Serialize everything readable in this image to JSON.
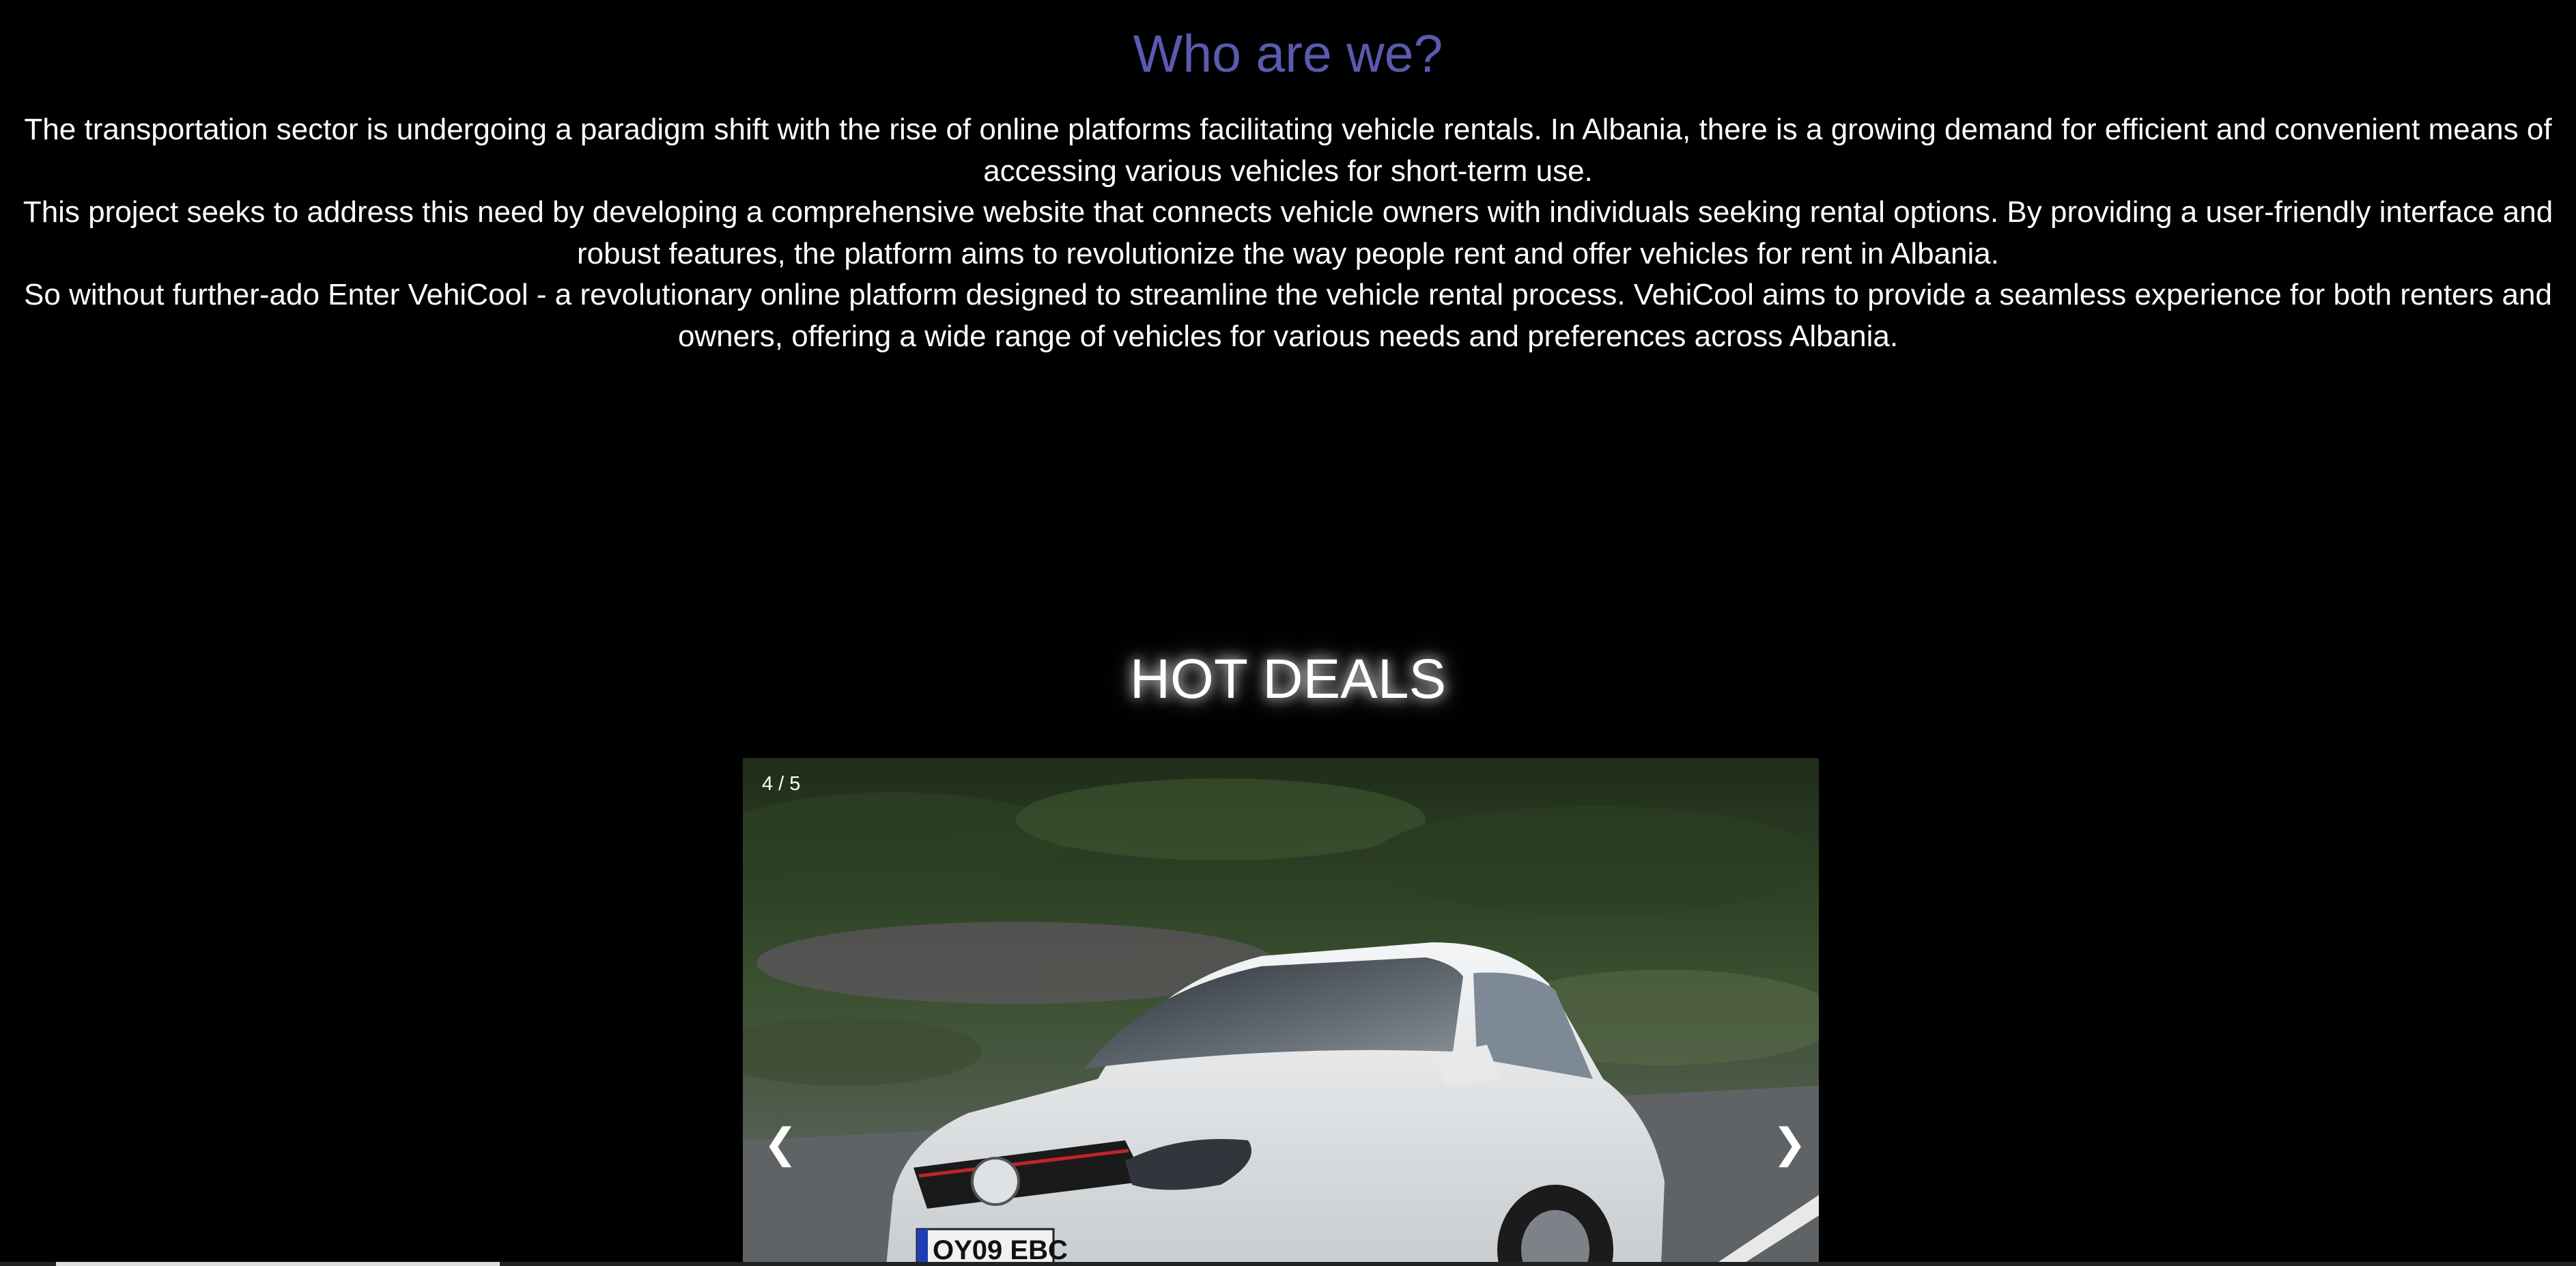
{
  "about": {
    "title": "Who are we?",
    "paragraphs": [
      "The transportation sector is undergoing a paradigm shift with the rise of online platforms facilitating vehicle rentals. In Albania, there is a growing demand for efficient and convenient means of accessing various vehicles for short-term use.",
      "This project seeks to address this need by developing a comprehensive website that connects vehicle owners with individuals seeking rental options. By providing a user-friendly interface and robust features, the platform aims to revolutionize the way people rent and offer vehicles for rent in Albania.",
      "So without further-ado Enter VehiCool - a revolutionary online platform designed to streamline the vehicle rental process. VehiCool aims to provide a seamless experience for both renters and owners, offering a wide range of vehicles for various needs and preferences across Albania."
    ]
  },
  "deals": {
    "title": "HOT DEALS",
    "counter": "4 / 5",
    "prev_label": "❮",
    "next_label": "❯",
    "plate": "OY09 EBC"
  },
  "colors": {
    "background": "#000000",
    "title_accent": "#5a5ab0",
    "text": "#ffffff"
  }
}
